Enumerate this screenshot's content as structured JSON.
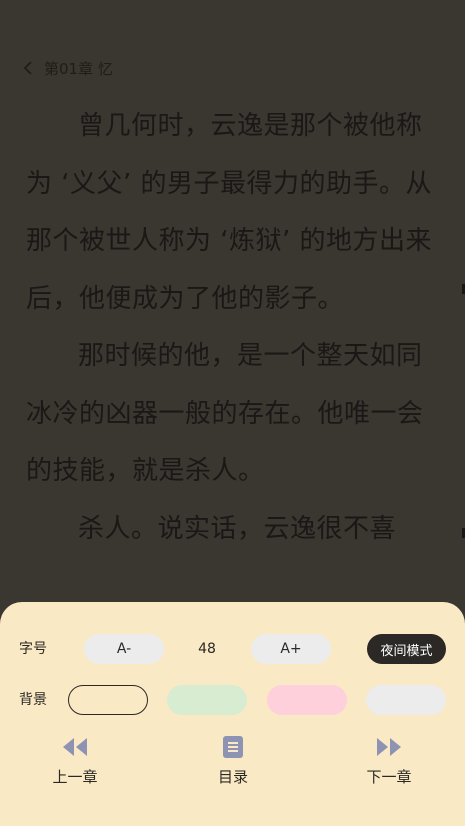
{
  "header": {
    "chapter_title": "第01章 忆"
  },
  "content": {
    "paragraphs": [
      "曾几何时，云逸是那个被他称为 ‘义父’ 的男子最得力的助手。从那个被世人称为 ‘炼狱’ 的地方出来后，他便成为了他的影子。",
      "那时候的他，是一个整天如同冰冷的凶器一般的存在。他唯一会的技能，就是杀人。",
      "杀人。说实话，云逸很不喜"
    ]
  },
  "settings": {
    "font_size_label": "字号",
    "decrease_label": "A-",
    "font_size_value": "48",
    "increase_label": "A+",
    "night_mode_label": "夜间模式",
    "background_label": "背景",
    "backgrounds": [
      {
        "name": "parchment",
        "color": "#f9e9c4",
        "selected": true
      },
      {
        "name": "green",
        "color": "#d8ecd2",
        "selected": false
      },
      {
        "name": "pink",
        "color": "#fdd0dc",
        "selected": false
      },
      {
        "name": "gray",
        "color": "#ececec",
        "selected": false
      }
    ]
  },
  "navigation": {
    "prev_label": "上一章",
    "toc_label": "目录",
    "next_label": "下一章",
    "icon_color": "#8e93b3"
  }
}
